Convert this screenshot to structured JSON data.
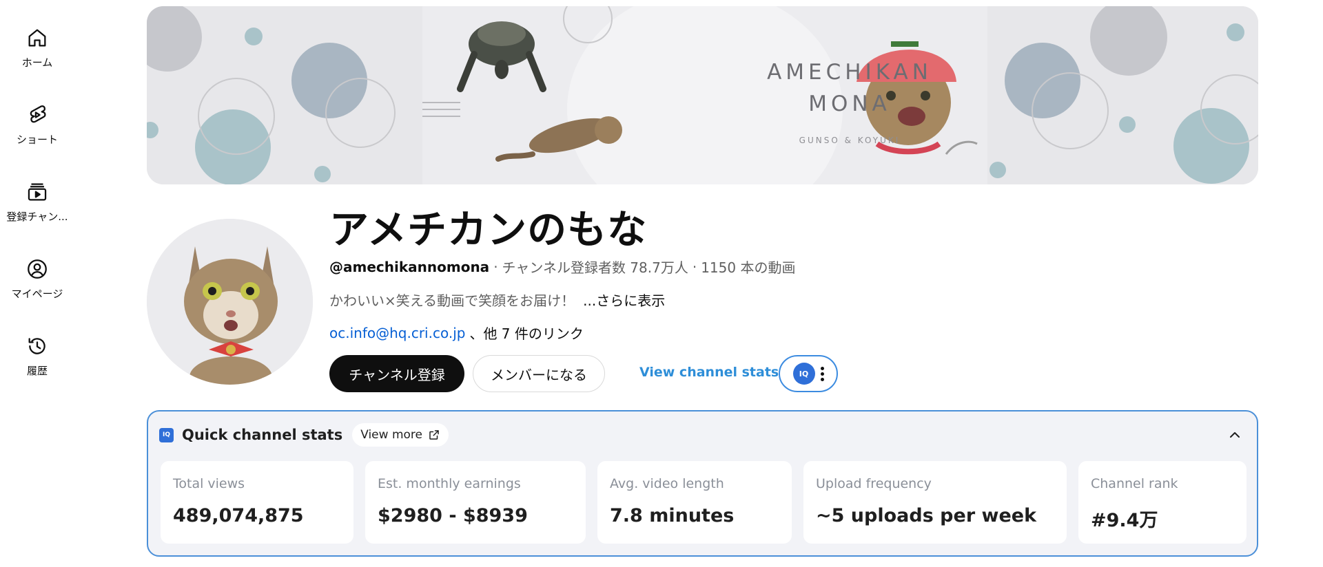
{
  "sidebar": {
    "items": [
      {
        "label": "ホーム",
        "icon": "home-icon"
      },
      {
        "label": "ショート",
        "icon": "shorts-icon"
      },
      {
        "label": "登録チャン...",
        "icon": "subscriptions-icon"
      },
      {
        "label": "マイページ",
        "icon": "account-icon"
      },
      {
        "label": "履歴",
        "icon": "history-icon"
      }
    ]
  },
  "banner": {
    "title_line1": "AMECHIKAN",
    "title_line2": "MONA",
    "subtitle": "GUNSO & KOYUKI"
  },
  "channel": {
    "title": "アメチカンのもな",
    "handle": "@amechikannomona",
    "separator": "·",
    "subscribers": "チャンネル登録者数 78.7万人",
    "video_count": "1150 本の動画",
    "description": "かわいい×笑える動画で笑顔をお届け！",
    "more_label": "...さらに表示",
    "email": "oc.info@hq.cri.co.jp",
    "more_links": "、他 7 件のリンク"
  },
  "actions": {
    "subscribe": "チャンネル登録",
    "join": "メンバーになる",
    "view_stats": "View channel stats",
    "extension_logo": "IQ"
  },
  "quick_stats": {
    "title": "Quick channel stats",
    "view_more": "View more",
    "logo": "IQ",
    "cards": [
      {
        "label": "Total views",
        "value": "489,074,875"
      },
      {
        "label": "Est. monthly earnings",
        "value": "$2980 - $8939"
      },
      {
        "label": "Avg. video length",
        "value": "7.8 minutes"
      },
      {
        "label": "Upload frequency",
        "value": "~5 uploads per week"
      },
      {
        "label": "Channel rank",
        "value": "#9.4万"
      }
    ]
  },
  "colors": {
    "accent_blue": "#2e8ed8",
    "panel_border": "#4a8fd8",
    "link_blue": "#065fd4",
    "subscribe_bg": "#0f0f0f"
  }
}
